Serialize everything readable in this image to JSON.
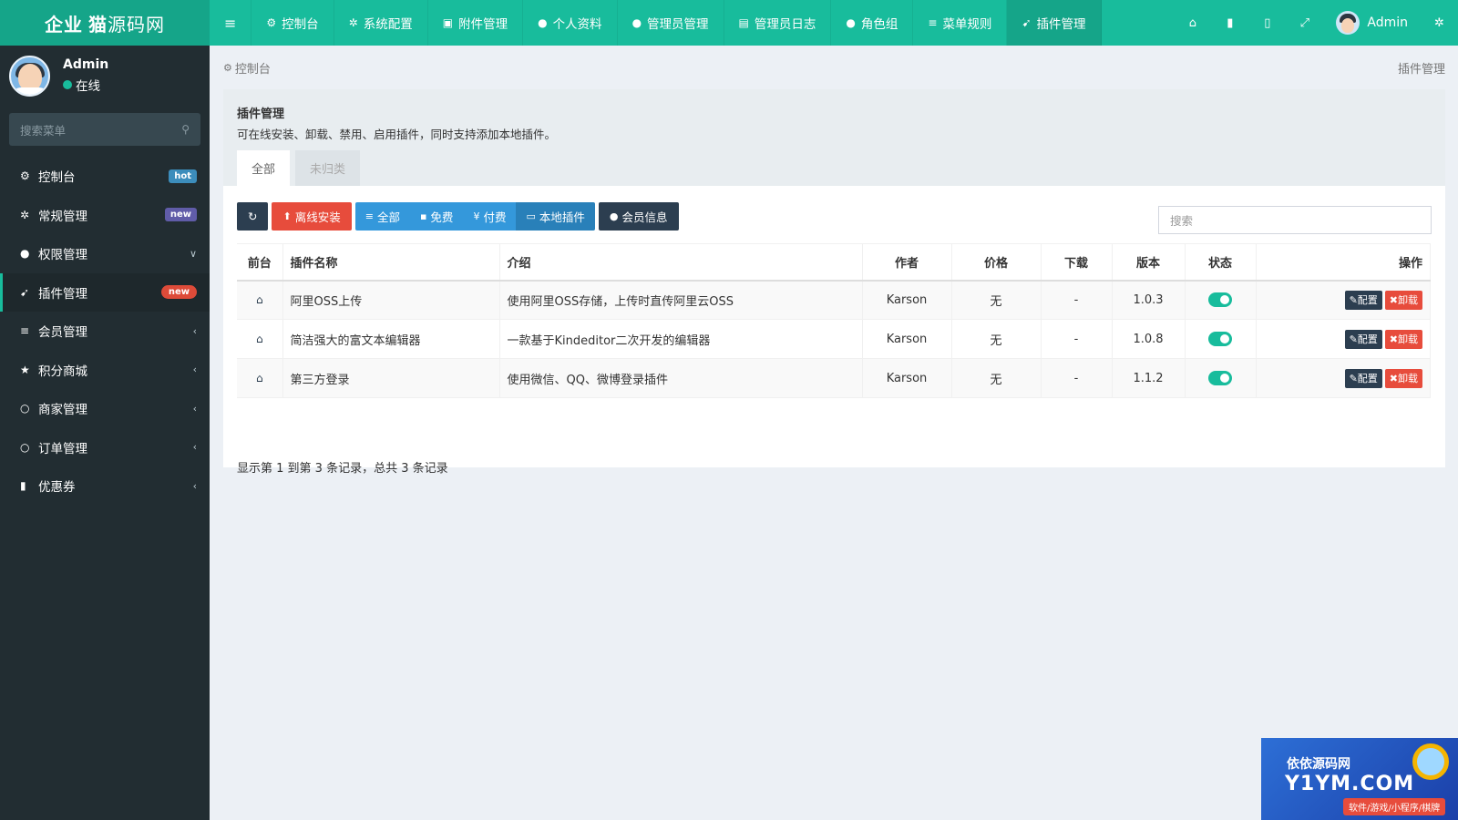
{
  "brand": {
    "part1": "企业",
    "part2": "猫",
    "part3": "源码网"
  },
  "topnav": {
    "items": [
      {
        "icon": "dashboard-icon",
        "glyph": "⚙",
        "label": "控制台"
      },
      {
        "icon": "gear-icon",
        "glyph": "✲",
        "label": "系统配置"
      },
      {
        "icon": "file-image-icon",
        "glyph": "▣",
        "label": "附件管理"
      },
      {
        "icon": "user-icon",
        "glyph": "●",
        "label": "个人资料"
      },
      {
        "icon": "user-icon",
        "glyph": "●",
        "label": "管理员管理"
      },
      {
        "icon": "list-alt-icon",
        "glyph": "▤",
        "label": "管理员日志"
      },
      {
        "icon": "group-icon",
        "glyph": "●",
        "label": "角色组"
      },
      {
        "icon": "bars-icon",
        "glyph": "≡",
        "label": "菜单规则"
      },
      {
        "icon": "rocket-icon",
        "glyph": "➹",
        "label": "插件管理"
      }
    ],
    "user": "Admin"
  },
  "sidebar": {
    "user_name": "Admin",
    "user_status": "在线",
    "search_placeholder": "搜索菜单",
    "items": [
      {
        "label": "控制台",
        "badge": "hot",
        "icon": "dashboard-icon"
      },
      {
        "label": "常规管理",
        "badge": "new",
        "icon": "cogs-icon"
      },
      {
        "label": "权限管理",
        "chevron": "∨",
        "icon": "group-icon"
      },
      {
        "label": "插件管理",
        "badge": "new",
        "icon": "rocket-icon"
      },
      {
        "label": "会员管理",
        "chevron": "‹",
        "icon": "list-icon"
      },
      {
        "label": "积分商城",
        "chevron": "‹",
        "icon": "star-icon"
      },
      {
        "label": "商家管理",
        "chevron": "‹",
        "icon": "circle-icon"
      },
      {
        "label": "订单管理",
        "chevron": "‹",
        "icon": "circle-icon"
      },
      {
        "label": "优惠券",
        "chevron": "‹",
        "icon": "bookmark-icon"
      }
    ]
  },
  "content": {
    "breadcrumb": "控制台",
    "breadcrumb_right": "插件管理",
    "panel_title": "插件管理",
    "panel_desc": "可在线安装、卸载、禁用、启用插件，同时支持添加本地插件。",
    "tabs": [
      "全部",
      "未归类"
    ],
    "toolbar": {
      "offline_install": "离线安装",
      "group": [
        "全部",
        "免费",
        "付费",
        "本地插件"
      ],
      "member_info": "会员信息",
      "search_placeholder": "搜索"
    },
    "table": {
      "headers": [
        "前台",
        "插件名称",
        "介绍",
        "作者",
        "价格",
        "下载",
        "版本",
        "状态",
        "操作"
      ],
      "rows": [
        {
          "name": "阿里OSS上传",
          "intro": "使用阿里OSS存储，上传时直传阿里云OSS",
          "author": "Karson",
          "price": "无",
          "download": "-",
          "version": "1.0.3"
        },
        {
          "name": "简洁强大的富文本编辑器",
          "intro": "一款基于Kindeditor二次开发的编辑器",
          "author": "Karson",
          "price": "无",
          "download": "-",
          "version": "1.0.8"
        },
        {
          "name": "第三方登录",
          "intro": "使用微信、QQ、微博登录插件",
          "author": "Karson",
          "price": "无",
          "download": "-",
          "version": "1.1.2"
        }
      ],
      "op_config": "配置",
      "op_unload": "卸载"
    },
    "summary": "显示第 1 到第 3 条记录，总共 3 条记录"
  },
  "watermark": {
    "line1": "依依源码网",
    "line2": "Y1YM.COM",
    "line3": "软件/游戏/小程序/棋牌"
  },
  "colors": {
    "accent": "#18bc9c",
    "sidebar_bg": "#222d32",
    "danger": "#e74c3c",
    "primary": "#3498db",
    "dark": "#2c3e50"
  }
}
